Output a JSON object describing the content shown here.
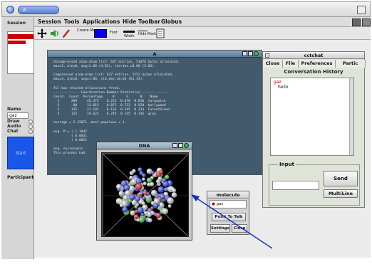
{
  "app": {
    "title_pill": "A"
  },
  "left_panel": {
    "session_label": "Session",
    "list_items": [
      "",
      ""
    ],
    "name_label": "Name",
    "name_value": "gaz",
    "options": [
      "Draw",
      "Audio",
      "Chat"
    ],
    "start_label": "Start",
    "participants_label": "Participants"
  },
  "menubar": {
    "items": [
      "Session",
      "Tools",
      "Applications",
      "Hide Toolbar",
      "Globus"
    ]
  },
  "toolbar": {
    "create_mark": "Create Mark",
    "font": "Font",
    "width": "Width",
    "hide_marks": "Hide Marks",
    "swatch_color": "#0000ee"
  },
  "win_a": {
    "title": "A",
    "terminal_lines": [
      "Uncompressed atom-atom list: 637 entries, 51076 bytes allocated.",
      "max=3, min=0, avg=1.08 (4.83), std.dev.=0.66 (3.03).",
      "",
      "Compressed atom-atom list: 637 entries, 5252 bytes allocated.",
      "max=3, min=0, avg=1.08, std.dev.=0.66 (61.33).",
      "",
      "All bon-related allocations freed.",
      "------------- Coordination Number Statistics -------------",
      "Coord.  Count  Percentage     R      G      B    Name",
      "  1      289     45.373    0.251  0.878  0.816  turquoise",
      "  2       88     13.815    0.871  0.722  0.529  burlywood",
      "  3      135     21.193    0.133  0.545  0.133  ForestGreen",
      "  4      125     19.623    0.745  0.745  0.745  gray",
      "",
      "average = 2.15071, most populous = 1.",
      "",
      "avg. M = ( 1.1942",
      "         ( 0.0021",
      "         ( 0.0022",
      "",
      "avg. eucrosomic",
      "This process had"
    ]
  },
  "win_dna": {
    "title": "DNA"
  },
  "win_chat": {
    "title": "cctchat",
    "tabs": [
      "Close",
      "File",
      "Preferences",
      "Partic"
    ],
    "history_label": "Conversation History",
    "messages": [
      {
        "user": "gaz",
        "text": "hello"
      }
    ],
    "input_label": "Input",
    "input_value": "",
    "send_label": "Send",
    "multiline_label": "MultiLine"
  },
  "win_molecule": {
    "title": "molecule",
    "list_item": "gaz",
    "point_to_talk": "Point To Talk",
    "settings": "Settings",
    "close": "Close"
  },
  "colors": {
    "accent_blue": "#1a56e8",
    "arrow": "#1b2ec8",
    "terminal_bg": "#415a6e",
    "user_red": "#c00000"
  }
}
